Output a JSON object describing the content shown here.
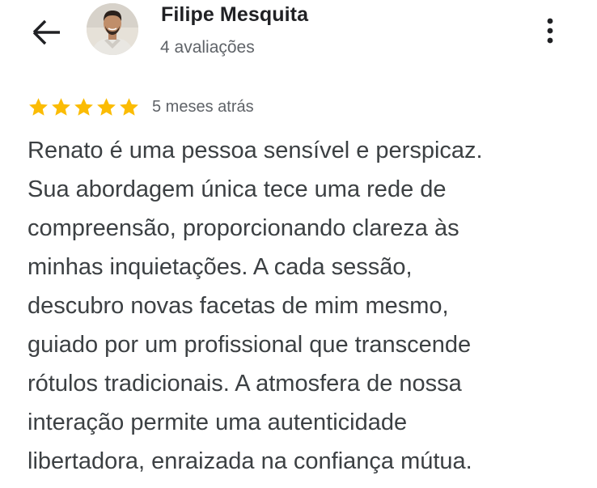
{
  "header": {
    "back_icon": "arrow-back-icon",
    "avatar_icon": "profile-photo",
    "reviewer_name": "Filipe Mesquita",
    "review_count": "4 avaliações",
    "more_icon": "more-vert-icon"
  },
  "review": {
    "rating": 5,
    "rating_max": 5,
    "star_color": "#fbbc04",
    "time_ago": "5 meses atrás",
    "lines": [
      "Renato é uma pessoa sensível e perspicaz.",
      "Sua abordagem única tece uma rede de",
      "compreensão, proporcionando clareza às",
      "minhas inquietações. A cada sessão,",
      "descubro novas facetas de mim mesmo,",
      "guiado por um profissional que transcende",
      "rótulos tradicionais. A atmosfera de nossa",
      "interação permite uma autenticidade",
      "libertadora, enraizada na confiança mútua."
    ]
  }
}
